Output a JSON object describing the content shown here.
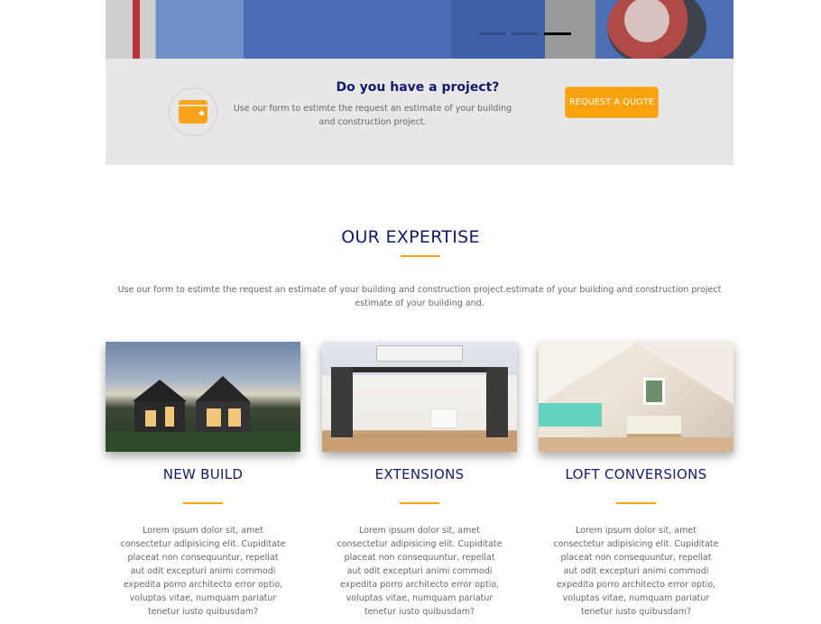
{
  "hero": {
    "slider_dots": [
      false,
      false,
      true
    ]
  },
  "banner": {
    "icon": "wallet-icon",
    "title": "Do you have a project?",
    "text": "Use our form to estimte the request an estimate of your building and construction project.",
    "button_label": "REQUEST A QUOTE",
    "accent_color": "#fba20c"
  },
  "expertise": {
    "title": "OUR EXPERTISE",
    "intro": "Use our form to estimte the request an estimate of your building and construction project.estimate of your building and construction project estimate of your building and.",
    "cards": [
      {
        "title": "NEW BUILD",
        "text": "Lorem ipsum dolor sit, amet consectetur adipisicing elit. Cupiditate placeat non consequuntur, repellat aut odit excepturi animi commodi expedita porro architecto error optio, voluptas vitae, numquam pariatur tenetur iusto quibusdam?"
      },
      {
        "title": "EXTENSIONS",
        "text": "Lorem ipsum dolor sit, amet consectetur adipisicing elit. Cupiditate placeat non consequuntur, repellat aut odit excepturi animi commodi expedita porro architecto error optio, voluptas vitae, numquam pariatur tenetur iusto quibusdam?"
      },
      {
        "title": "LOFT CONVERSIONS",
        "text": "Lorem ipsum dolor sit, amet consectetur adipisicing elit. Cupiditate placeat non consequuntur, repellat aut odit excepturi animi commodi expedita porro architecto error optio, voluptas vitae, numquam pariatur tenetur iusto quibusdam?"
      }
    ],
    "title_color": "#131a6e",
    "accent_color": "#f7a31c"
  }
}
